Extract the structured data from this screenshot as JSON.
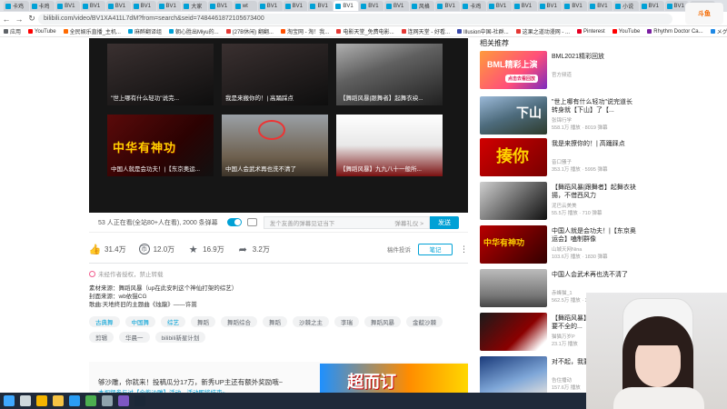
{
  "browser": {
    "tabs": [
      {
        "label": "卡鸡"
      },
      {
        "label": "卡鸡"
      },
      {
        "label": "BV1"
      },
      {
        "label": "BV1"
      },
      {
        "label": "BV1"
      },
      {
        "label": "BV1"
      },
      {
        "label": "BV1"
      },
      {
        "label": "大家"
      },
      {
        "label": "BV1"
      },
      {
        "label": "wt"
      },
      {
        "label": "BV1"
      },
      {
        "label": "BV1"
      },
      {
        "label": "BV1"
      },
      {
        "label": "BV1"
      },
      {
        "label": "BV1"
      },
      {
        "label": "BV1"
      },
      {
        "label": "风格"
      },
      {
        "label": "BV1"
      },
      {
        "label": "卡鸡"
      },
      {
        "label": "BV1"
      },
      {
        "label": "BV1"
      },
      {
        "label": "BV1"
      },
      {
        "label": "BV1"
      },
      {
        "label": "BV1"
      },
      {
        "label": "小说"
      },
      {
        "label": "BV1"
      },
      {
        "label": "BV1"
      },
      {
        "label": "巴等"
      }
    ],
    "active_tab": 13,
    "url": "bilibili.com/video/BV1XA411L7dM?from=search&seid=7484461872105673400",
    "bookmarks": [
      {
        "label": "应用",
        "color": "#5f6368"
      },
      {
        "label": "YouTube",
        "color": "#ff0000"
      },
      {
        "label": "全民娱乐直播_主机...",
        "color": "#ff6a00"
      },
      {
        "label": "麻醉翻译组",
        "color": "#00a1d6"
      },
      {
        "label": "朝心胜出Miyu的...",
        "color": "#00a1d6"
      },
      {
        "label": "(27B休闲) 翻翻...",
        "color": "#e53935"
      },
      {
        "label": "淘宝网 - 淘！我...",
        "color": "#ff5000"
      },
      {
        "label": "电影天堂_免费电影...",
        "color": "#e53935"
      },
      {
        "label": "连网天堂 - 好看...",
        "color": "#e53935"
      },
      {
        "label": "Illusion中国-社群...",
        "color": "#3949ab"
      },
      {
        "label": "这果之道动漫网 - ...",
        "color": "#e53935"
      },
      {
        "label": "Pinterest",
        "color": "#e60023"
      },
      {
        "label": "YouTube",
        "color": "#ff0000"
      },
      {
        "label": "Rhythm Doctor Ca...",
        "color": "#7b1fa2"
      },
      {
        "label": "メグラネーター 2...",
        "color": "#1e88e5"
      },
      {
        "label": "阅读清单",
        "color": "#5f6368"
      }
    ],
    "logo_text": "斗鱼"
  },
  "player": {
    "end_videos": [
      {
        "label": "\"世上哪有什么轻功\"说完...",
        "style": "dark"
      },
      {
        "label": "我是来搬你的！| 高踊踩点",
        "style": "dark"
      },
      {
        "label": "【舞蹈风暴|跟舞者】起舞衣袂...",
        "style": "art"
      },
      {
        "label": "中国人就是会功夫！|【东京奥运...",
        "style": "red",
        "banner": "中华有神功"
      },
      {
        "label": "中国人会武术再也洗不清了",
        "style": "street"
      },
      {
        "label": "【舞蹈风暴】九九八十一般所...",
        "style": "cloud"
      }
    ]
  },
  "controls": {
    "viewers": "53 人正在看(全站80+人在看), 2000 条弹幕",
    "danmaku_placeholder": "发个友善的弹幕见证当下",
    "etiquette": "弹幕礼仪 >",
    "send": "发送"
  },
  "actions": {
    "like": "31.4万",
    "coin": "12.0万",
    "fav": "16.9万",
    "share": "3.2万",
    "report": "稿件投诉",
    "note": "笔记"
  },
  "notice": "未经作者授权，禁止转载",
  "description": [
    "素材来源：舞蹈风暴（up在此安利这个神仙打架的综艺）",
    "封面来源：wb依猫CG",
    "歌曲:天地终旧的主题曲《烛龍》——许嵩"
  ],
  "tags": [
    {
      "label": "古典舞",
      "blue": true
    },
    {
      "label": "中国舞",
      "blue": true
    },
    {
      "label": "综艺",
      "blue": true
    },
    {
      "label": "舞蹈",
      "blue": false
    },
    {
      "label": "舞蹈综合",
      "blue": false
    },
    {
      "label": "舞蹈",
      "blue": false
    },
    {
      "label": "沙棘之主",
      "blue": false
    },
    {
      "label": "李瑞",
      "blue": false
    },
    {
      "label": "舞蹈风暴",
      "blue": false
    },
    {
      "label": "金靛沙棘",
      "blue": false
    },
    {
      "label": "剪辑",
      "blue": false
    },
    {
      "label": "华晨一",
      "blue": false
    },
    {
      "label": "bilibili新星计划",
      "blue": false
    }
  ],
  "ad": {
    "line1": "够沙雕，你就来！投稿瓜分17万，新秀UP主还有额外奖励哦~",
    "line2": "本视频参与过【全能沙雕】活动，活动即将结束~",
    "image_text": "超而订"
  },
  "sidebar": {
    "title": "相关推荐",
    "items": [
      {
        "title": "BML2021精彩回放",
        "up": "官方频道",
        "stat": "",
        "style": "bml",
        "thumb_text": "BML精彩上演",
        "badge": "点击去看回放"
      },
      {
        "title": "\"世上哪有什么轻功\"说完道长转身就【下山】了【...",
        "up": "张锦行学",
        "stat": "558.1万 播放 · 8019 弹幕",
        "style": "fall",
        "thumb_text": "下山"
      },
      {
        "title": "我是来撩你的！| 高踊踩点",
        "up": "音口骚子",
        "stat": "353.1万 播放 · 5995 弹幕",
        "style": "kiss",
        "thumb_text": "揍你"
      },
      {
        "title": "【舞蹈风暴|跟舞者】起舞衣袂揚，不借西风力",
        "up": "泥巴云美美",
        "stat": "55.5万 播放 · 710 弹幕",
        "style": "dance",
        "thumb_text": ""
      },
      {
        "title": "中国人就是会功夫！|【东京奥运会】嗑制群像",
        "up": "山城天网Nina",
        "stat": "103.6万 播放 · 1830 弹幕",
        "style": "kungfu",
        "thumb_text": "中华有神功"
      },
      {
        "title": "中国人会武术再也洗不清了",
        "up": "赤峰猫_1",
        "stat": "562.5万 播放 · 3.4万 弹幕",
        "style": "martial",
        "thumb_text": ""
      },
      {
        "title": "【舞蹈风暴】九九八十一般所要不全的...",
        "up": "猫猫万岁P",
        "stat": "23.1万 播放",
        "style": "darkred",
        "thumb_text": ""
      },
      {
        "title": "对不起，我要...无所知",
        "up": "告住播动",
        "stat": "157.6万 播放",
        "style": "blue",
        "thumb_text": ""
      }
    ]
  },
  "taskbar": {
    "apps": [
      "windows",
      "search",
      "chrome",
      "files",
      "edge",
      "mail",
      "app6",
      "app7",
      "steam"
    ]
  }
}
